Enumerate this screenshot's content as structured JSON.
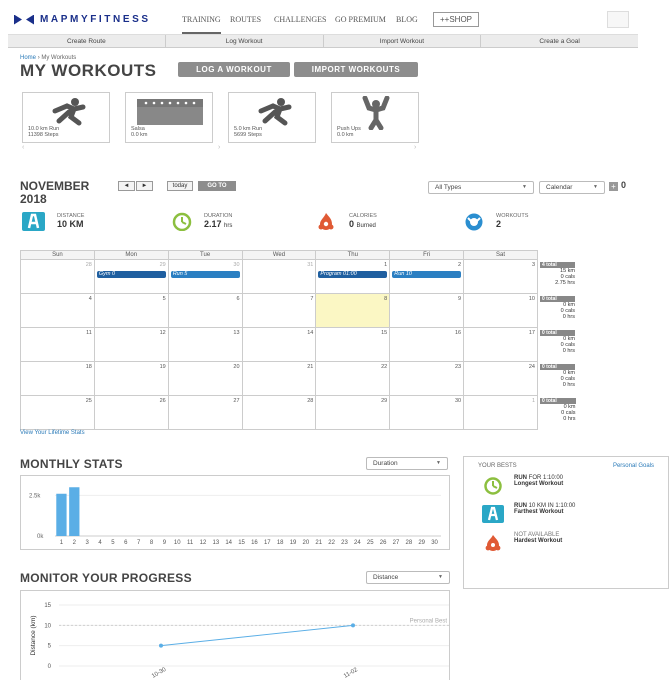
{
  "brand": {
    "name": "MAPMYFITNESS",
    "color": "#1a2f8a"
  },
  "nav": {
    "training": "TRAINING",
    "routes": "ROUTES",
    "challenges": "CHALLENGES",
    "go_premium": "GO PREMIUM",
    "blog": "BLOG",
    "shop": "++SHOP"
  },
  "subnav": {
    "create_route": "Create Route",
    "log_workout": "Log Workout",
    "import_workout": "Import Workout",
    "create_goal": "Create a Goal"
  },
  "breadcrumb": {
    "home": "Home",
    "sep": "›",
    "current": "My Workouts"
  },
  "page": {
    "title": "MY WORKOUTS",
    "log_btn": "LOG A WORKOUT",
    "import_btn": "IMPORT WORKOUTS"
  },
  "cards": [
    {
      "line1": "10.0 km Run",
      "line2": "11398 Steps",
      "icon": "runner-icon"
    },
    {
      "line1": "Salsa",
      "line2": "0.0 km",
      "icon": "calendar-icon"
    },
    {
      "line1": "5.0 km Run",
      "line2": "5699 Steps",
      "icon": "runner-icon"
    },
    {
      "line1": "Push Ups",
      "line2": "0.0 km",
      "icon": "pushup-icon"
    }
  ],
  "calendar_header": {
    "month": "NOVEMBER",
    "year": "2018",
    "prev": "◄",
    "next": "►",
    "today": "today",
    "goto": "GO TO",
    "types": "All Types",
    "view": "Calendar",
    "zero": "0"
  },
  "stats": {
    "distance": {
      "label": "DISTANCE",
      "value": "10 KM",
      "color": "#2aa7c6"
    },
    "duration": {
      "label": "DURATION",
      "value": "2.17",
      "unit": "hrs",
      "color": "#8cbf3f"
    },
    "calories": {
      "label": "CALORIES",
      "value": "0",
      "unit": "Burned",
      "color": "#e05a35"
    },
    "workouts": {
      "label": "WORKOUTS",
      "value": "2",
      "color": "#2a8ed0"
    }
  },
  "weekdays": [
    "Sun",
    "Mon",
    "Tue",
    "Wed",
    "Thu",
    "Fri",
    "Sat"
  ],
  "weeks": [
    {
      "days": [
        "28",
        "29",
        "30",
        "31",
        "1",
        "2",
        "3"
      ],
      "summary": {
        "total": "4 total",
        "km": "15 km",
        "cals": "0 cals",
        "hrs": "2.75 hrs"
      }
    },
    {
      "days": [
        "4",
        "5",
        "6",
        "7",
        "8",
        "9",
        "10"
      ],
      "summary": {
        "total": "0 total",
        "km": "0 km",
        "cals": "0 cals",
        "hrs": "0 hrs"
      }
    },
    {
      "days": [
        "11",
        "12",
        "13",
        "14",
        "15",
        "16",
        "17"
      ],
      "summary": {
        "total": "0 total",
        "km": "0 km",
        "cals": "0 cals",
        "hrs": "0 hrs"
      }
    },
    {
      "days": [
        "18",
        "19",
        "20",
        "21",
        "22",
        "23",
        "24"
      ],
      "summary": {
        "total": "0 total",
        "km": "0 km",
        "cals": "0 cals",
        "hrs": "0 hrs"
      }
    },
    {
      "days": [
        "25",
        "26",
        "27",
        "28",
        "29",
        "30",
        "1"
      ],
      "summary": {
        "total": "0 total",
        "km": "0 km",
        "cals": "0 cals",
        "hrs": "0 hrs"
      }
    }
  ],
  "events": {
    "gym": "Gym 0",
    "run5": "Run 5",
    "program": "Program 01:00",
    "run10": "Run 10"
  },
  "lifetime_link": "View Your Lifetime Stats",
  "monthly": {
    "title": "MONTHLY STATS",
    "select": "Duration"
  },
  "progress": {
    "title": "MONITOR YOUR PROGRESS",
    "select": "Distance",
    "personal_best": "Personal Best",
    "ylabel": "Distance (km)"
  },
  "bests": {
    "header": "YOUR BESTS",
    "link": "Personal Goals",
    "items": [
      {
        "line1_bold": "RUN",
        "line1": "FOR 1:10:00",
        "line2": "Longest Workout"
      },
      {
        "line1_bold": "RUN",
        "line1": "10 KM IN 1:10:00",
        "line2": "Farthest Workout"
      },
      {
        "line1_bold": "",
        "line1": "NOT AVAILABLE",
        "line2": "Hardest Workout"
      }
    ]
  },
  "chart_data": [
    {
      "type": "bar",
      "categories": [
        "1",
        "2",
        "3",
        "4",
        "5",
        "6",
        "7",
        "8",
        "9",
        "10",
        "11",
        "12",
        "13",
        "14",
        "15",
        "16",
        "17",
        "18",
        "19",
        "20",
        "21",
        "22",
        "23",
        "24",
        "25",
        "26",
        "27",
        "28",
        "29",
        "30"
      ],
      "values": [
        2600,
        3000,
        0,
        0,
        0,
        0,
        0,
        0,
        0,
        0,
        0,
        0,
        0,
        0,
        0,
        0,
        0,
        0,
        0,
        0,
        0,
        0,
        0,
        0,
        0,
        0,
        0,
        0,
        0,
        0
      ],
      "ytick_labels": [
        "0k",
        "2.5k"
      ],
      "ylim": [
        0,
        3200
      ],
      "color": "#5aaee6"
    },
    {
      "type": "line",
      "x": [
        "10-30",
        "11-02"
      ],
      "values": [
        5,
        10
      ],
      "ylabel": "Distance (km)",
      "yticks": [
        0,
        5,
        10,
        15
      ],
      "ylim": [
        0,
        15
      ],
      "color": "#5aaee6"
    }
  ]
}
